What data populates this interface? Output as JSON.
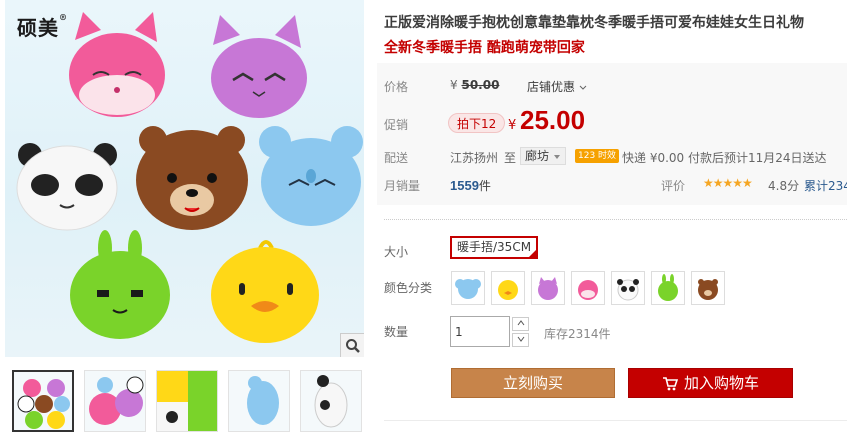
{
  "gallery": {
    "brand_logo": "硕美",
    "brand_mark": "®",
    "icons": {
      "zoom": "magnifier-icon"
    }
  },
  "product": {
    "title": "正版爱消除暖手抱枕创意靠垫靠枕冬季暖手捂可爱布娃娃女生日礼物",
    "subtitle": "全新冬季暖手捂 酷跑萌宠带回家"
  },
  "price": {
    "label": "价格",
    "currency": "¥",
    "original": "50.00",
    "store_promo": "店铺优惠",
    "promo_label": "促销",
    "promo_tag": "拍下12",
    "promo_price": "25.00"
  },
  "shipping": {
    "label": "配送",
    "origin": "江苏扬州",
    "to": "至",
    "destination": "廊坊",
    "express_badge": "123 时效",
    "info": "快递 ¥0.00 付款后预计11月24日送达"
  },
  "sales": {
    "label": "月销量",
    "count": "1559",
    "unit": "件",
    "rating_label": "评价",
    "stars": "★★★★★",
    "score": "4.8分",
    "total": "累计234"
  },
  "sku": {
    "size_label": "大小",
    "size_selected": "暖手捂/35CM",
    "color_label": "颜色分类",
    "colors": [
      "elephant",
      "chick",
      "cat-purple",
      "fox-pink",
      "panda",
      "rabbit-green",
      "bear-brown"
    ]
  },
  "quantity": {
    "label": "数量",
    "value": "1",
    "stock": "库存2314件"
  },
  "actions": {
    "buy_now": "立刻购买",
    "add_to_cart": "加入购物车",
    "icons": {
      "cart": "cart-icon"
    }
  },
  "colors": {
    "accent": "#c40000",
    "buy_button": "#c7844a",
    "link": "#2b5a8f"
  }
}
